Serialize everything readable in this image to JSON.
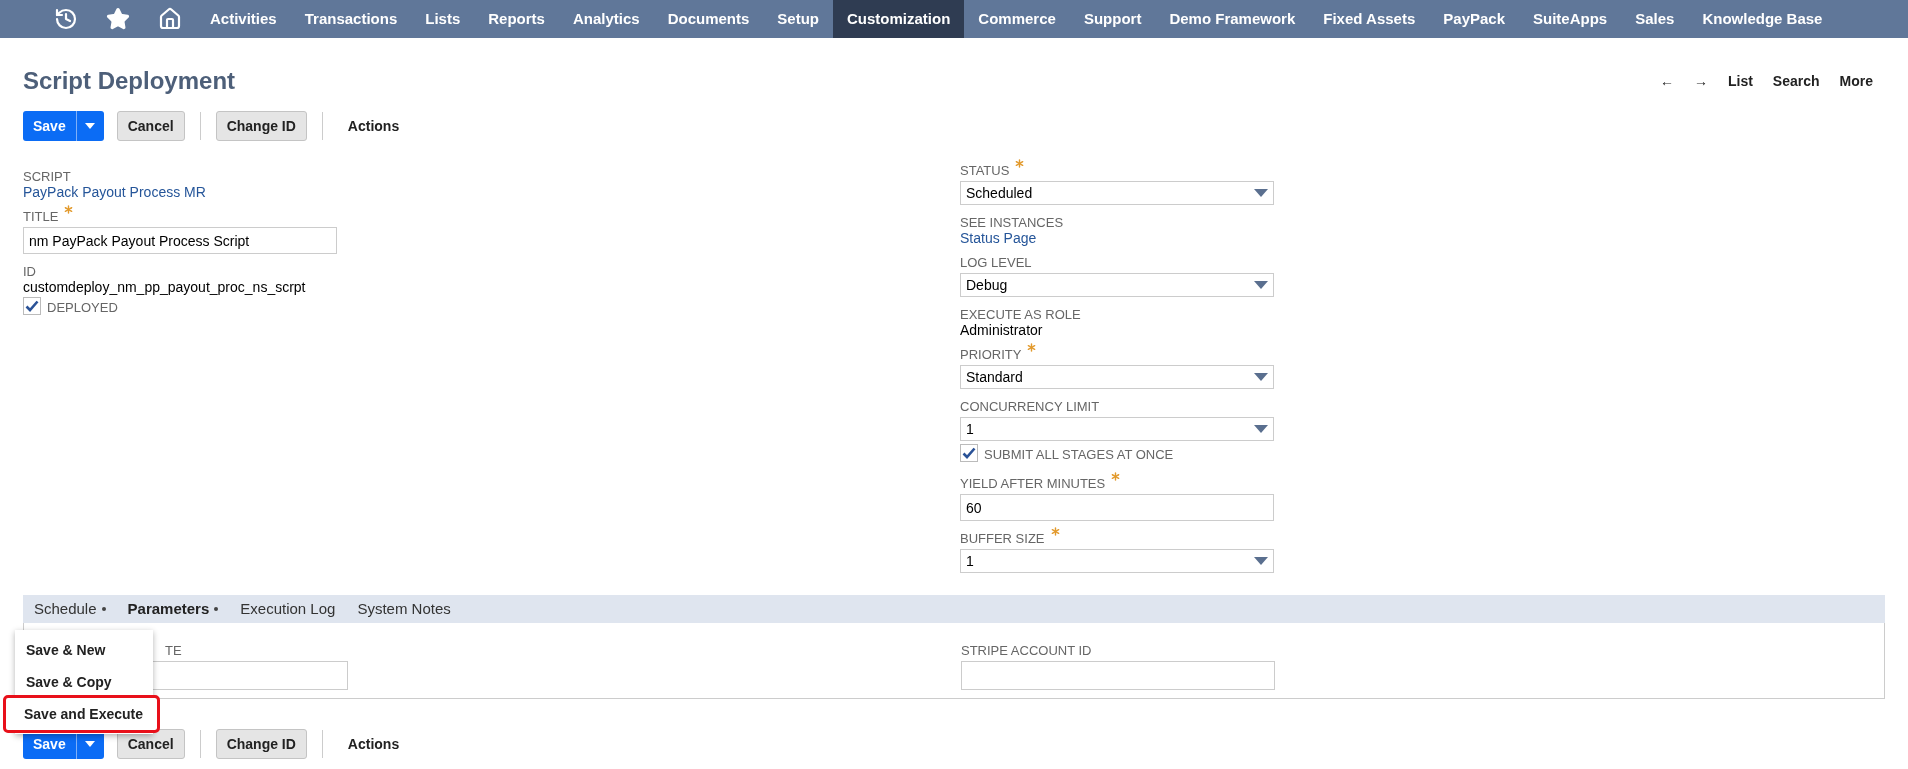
{
  "nav": {
    "items": [
      {
        "label": "Activities",
        "selected": false
      },
      {
        "label": "Transactions",
        "selected": false
      },
      {
        "label": "Lists",
        "selected": false
      },
      {
        "label": "Reports",
        "selected": false
      },
      {
        "label": "Analytics",
        "selected": false
      },
      {
        "label": "Documents",
        "selected": false
      },
      {
        "label": "Setup",
        "selected": false
      },
      {
        "label": "Customization",
        "selected": true
      },
      {
        "label": "Commerce",
        "selected": false
      },
      {
        "label": "Support",
        "selected": false
      },
      {
        "label": "Demo Framework",
        "selected": false
      },
      {
        "label": "Fixed Assets",
        "selected": false
      },
      {
        "label": "PayPack",
        "selected": false
      },
      {
        "label": "SuiteApps",
        "selected": false
      },
      {
        "label": "Sales",
        "selected": false
      },
      {
        "label": "Knowledge Base",
        "selected": false
      }
    ]
  },
  "page": {
    "title": "Script Deployment",
    "nav_links": [
      "←",
      "→",
      "List",
      "Search",
      "More"
    ]
  },
  "toolbar_top": {
    "buttons": [
      {
        "kind": "primary",
        "label": "Save"
      },
      {
        "kind": "secondary",
        "label": "Cancel"
      },
      {
        "kind": "secondary",
        "label": "Change ID"
      },
      {
        "kind": "plain",
        "label": "Actions"
      }
    ]
  },
  "left_fields": [
    {
      "kind": "link",
      "label": "SCRIPT",
      "required": false,
      "value": "PayPack Payout Process MR"
    },
    {
      "kind": "input",
      "label": "TITLE",
      "required": true,
      "value": "nm PayPack Payout Process Script"
    },
    {
      "kind": "text",
      "label": "ID",
      "required": false,
      "value": "customdeploy_nm_pp_payout_proc_ns_scrpt"
    },
    {
      "kind": "checkbox",
      "label": "DEPLOYED",
      "checked": true
    }
  ],
  "right_fields": [
    {
      "kind": "select",
      "label": "STATUS",
      "required": true,
      "value": "Scheduled"
    },
    {
      "kind": "link",
      "label": "SEE INSTANCES",
      "required": false,
      "value": "Status Page"
    },
    {
      "kind": "select",
      "label": "LOG LEVEL",
      "required": false,
      "value": "Debug"
    },
    {
      "kind": "text",
      "label": "EXECUTE AS ROLE",
      "required": false,
      "value": "Administrator"
    },
    {
      "kind": "select",
      "label": "PRIORITY",
      "required": true,
      "value": "Standard"
    },
    {
      "kind": "select",
      "label": "CONCURRENCY LIMIT",
      "required": false,
      "value": "1"
    },
    {
      "kind": "checkbox",
      "label": "SUBMIT ALL STAGES AT ONCE",
      "checked": true
    },
    {
      "kind": "input",
      "label": "YIELD AFTER MINUTES",
      "required": true,
      "value": "60"
    },
    {
      "kind": "select",
      "label": "BUFFER SIZE",
      "required": true,
      "value": "1"
    }
  ],
  "subtabs": [
    {
      "label": "Schedule",
      "marked": true,
      "selected": false
    },
    {
      "label": "Parameters",
      "marked": true,
      "selected": true
    },
    {
      "label": "Execution Log",
      "marked": false,
      "selected": false
    },
    {
      "label": "System Notes",
      "marked": false,
      "selected": false
    }
  ],
  "subtab_fields": [
    {
      "kind": "input",
      "label": "TE"
    },
    {
      "kind": "input",
      "label": "STRIPE ACCOUNT ID"
    }
  ],
  "menu": {
    "items": [
      {
        "label": "Save & New",
        "highlighted": false
      },
      {
        "label": "Save & Copy",
        "highlighted": false
      },
      {
        "label": "Save and Execute",
        "highlighted": true
      }
    ]
  },
  "toolbar_bottom": {
    "buttons": [
      {
        "kind": "primary",
        "label": "Save"
      },
      {
        "kind": "secondary",
        "label": "Cancel"
      },
      {
        "kind": "secondary",
        "label": "Change ID"
      },
      {
        "kind": "plain",
        "label": "Actions"
      }
    ]
  }
}
